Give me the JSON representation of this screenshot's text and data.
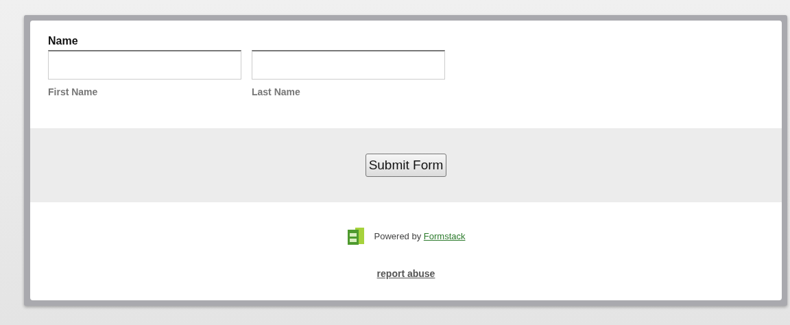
{
  "field": {
    "label": "Name",
    "inputs": [
      {
        "sublabel": "First Name"
      },
      {
        "sublabel": "Last Name"
      }
    ]
  },
  "submit_button": "Submit Form",
  "footer": {
    "powered_by": "Powered by",
    "powered_link": "Formstack",
    "report_link": "report abuse"
  }
}
